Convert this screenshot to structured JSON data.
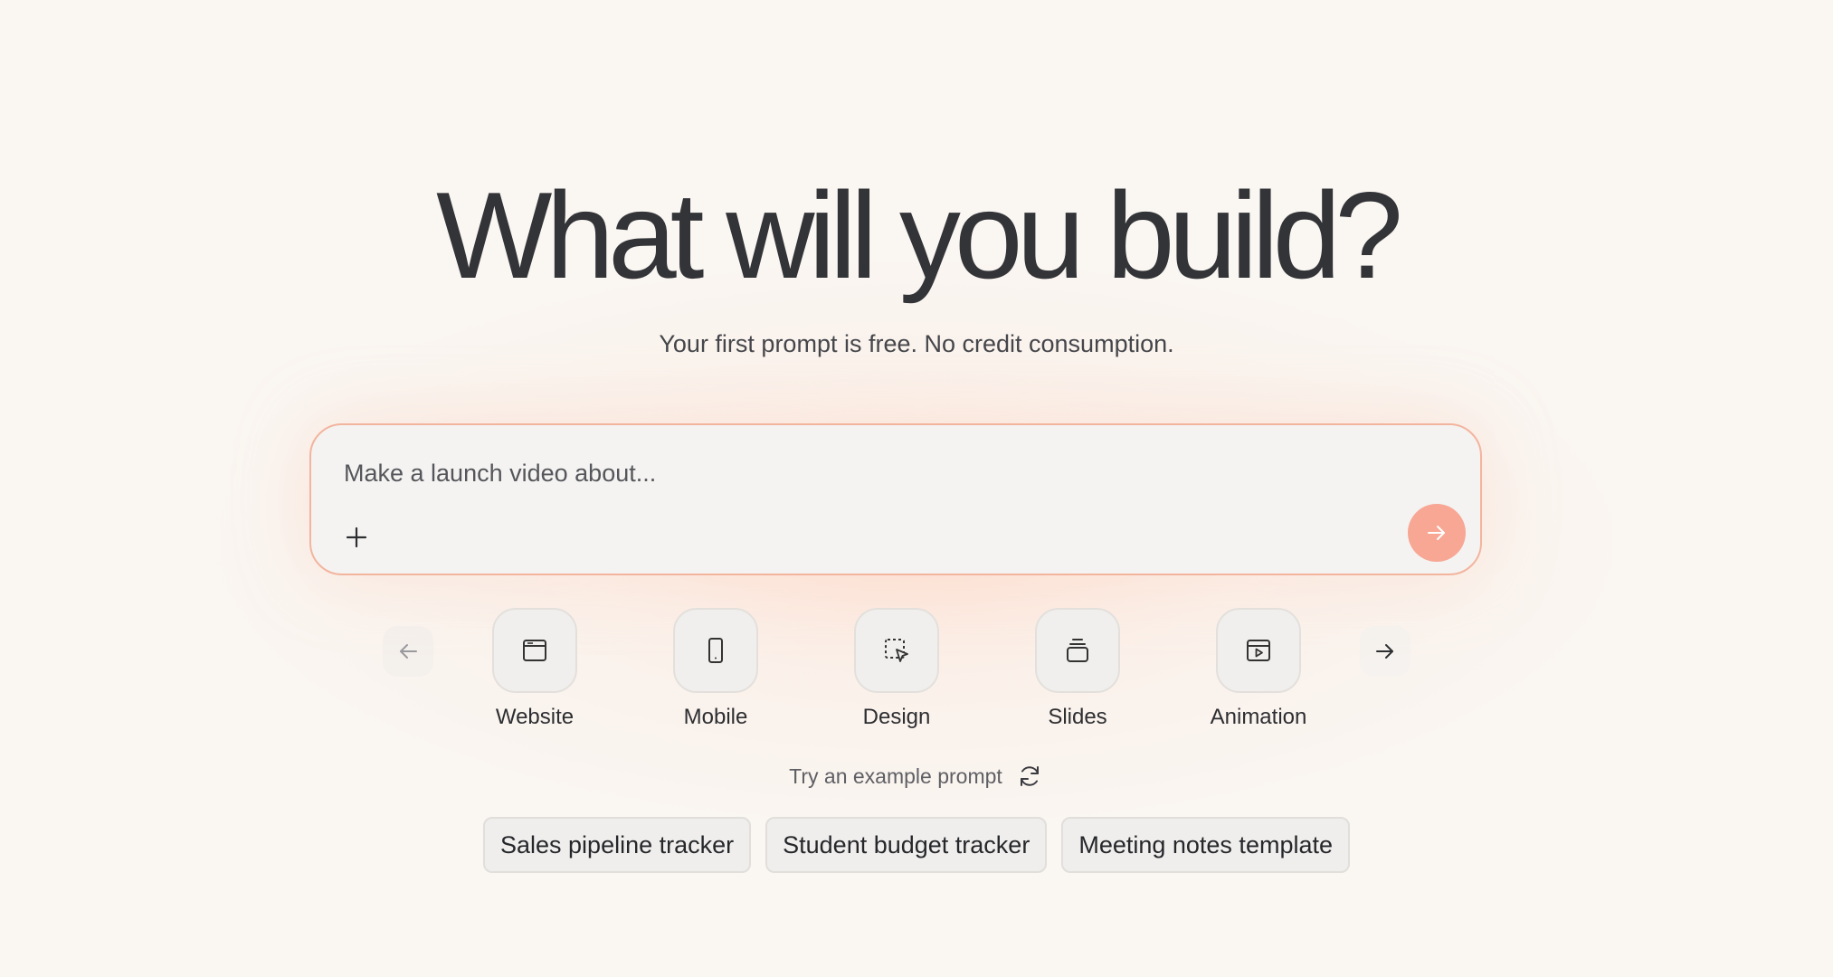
{
  "hero": {
    "title": "What will you build?",
    "subtitle": "Your first prompt is free. No credit consumption."
  },
  "prompt": {
    "placeholder": "Make a launch video about...",
    "value": "",
    "add_icon": "plus-icon",
    "send_icon": "arrow-right-icon"
  },
  "categories": {
    "prev_icon": "arrow-left-icon",
    "next_icon": "arrow-right-icon",
    "items": [
      {
        "label": "Website",
        "icon": "browser-window-icon"
      },
      {
        "label": "Mobile",
        "icon": "smartphone-icon"
      },
      {
        "label": "Design",
        "icon": "cursor-selection-icon"
      },
      {
        "label": "Slides",
        "icon": "slides-stack-icon"
      },
      {
        "label": "Animation",
        "icon": "play-window-icon"
      }
    ]
  },
  "examples": {
    "label": "Try an example prompt",
    "refresh_icon": "refresh-icon",
    "chips": [
      "Sales pipeline tracker",
      "Student budget tracker",
      "Meeting notes template"
    ]
  },
  "colors": {
    "accent": "#f7a794",
    "prompt_border": "#f3b49e",
    "background": "#faf6f2",
    "text": "#333438"
  }
}
